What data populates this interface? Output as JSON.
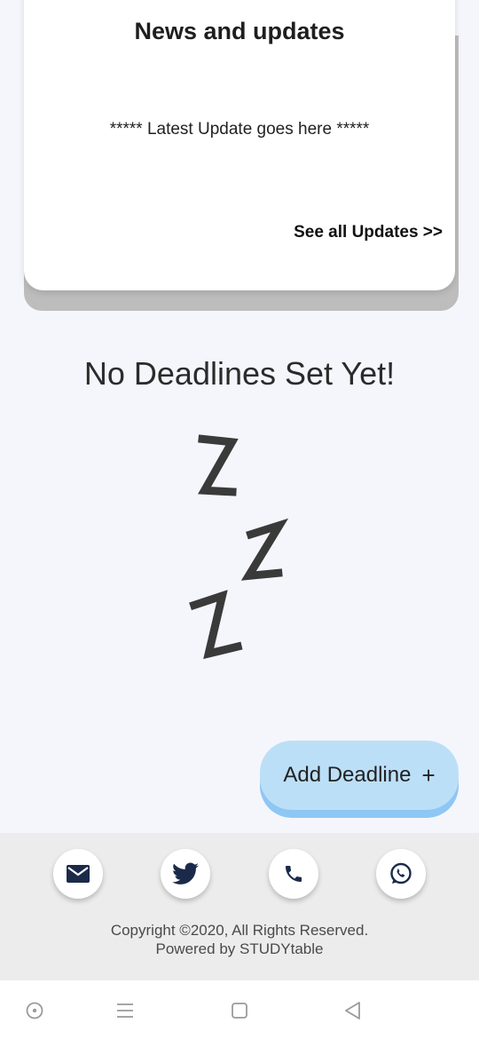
{
  "news": {
    "title": "News and updates",
    "latest": "***** Latest Update goes here *****",
    "see_all": "See all Updates >>"
  },
  "deadlines": {
    "empty_message": "No Deadlines Set Yet!",
    "add_button_label": "Add Deadline",
    "add_button_plus": "+"
  },
  "footer": {
    "social_icons": [
      "mail-icon",
      "twitter-icon",
      "phone-icon",
      "whatsapp-icon"
    ],
    "copyright": "Copyright ©2020, All Rights Reserved.",
    "powered_by": "Powered by STUDYtable"
  },
  "navbar": {
    "icons": [
      "circle-dot-icon",
      "menu-icon",
      "home-square-icon",
      "back-triangle-icon"
    ]
  },
  "colors": {
    "background": "#f5f6fb",
    "button_blue": "#bcdff8",
    "icon_navy": "#1b2a4a",
    "zzz_gray": "#3a3a3a"
  }
}
